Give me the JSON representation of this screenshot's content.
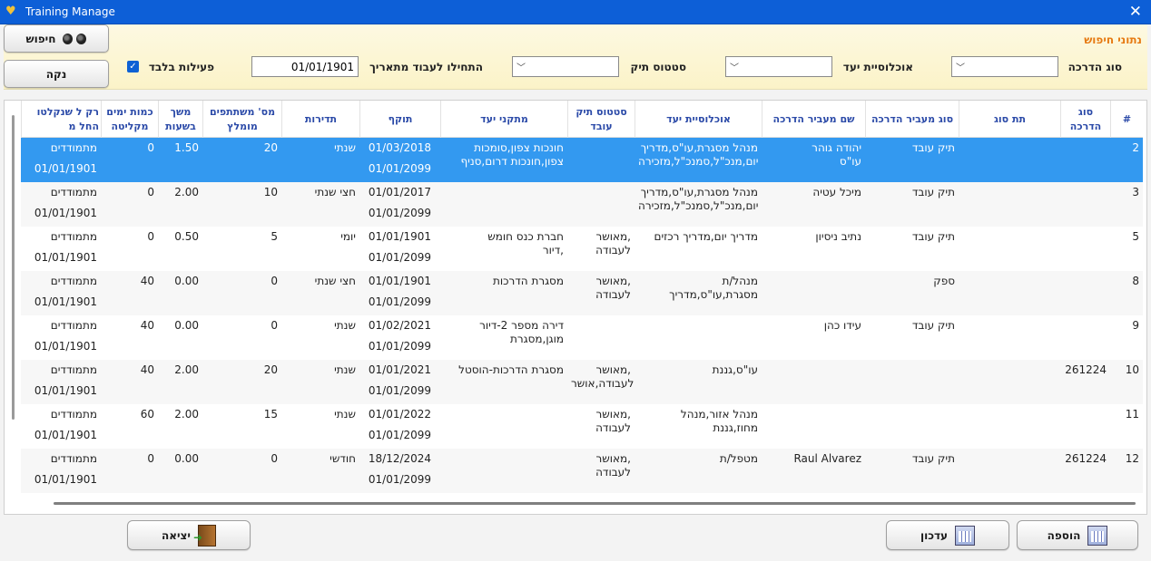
{
  "window": {
    "title": "Training Manage"
  },
  "search_panel": {
    "title": "נתוני חיפוש",
    "search_label": "חיפוש",
    "clear_label": "נקה",
    "fields": {
      "training_type_label": "סוג הדרכה",
      "target_population_label": "אוכלוסיית יעד",
      "file_status_label": "סטטוס תיק",
      "start_date_label": "התחילו לעבוד מתאריך",
      "start_date_value": "01/01/1901",
      "active_only_label": "פעילות בלבד",
      "active_only_checked": true
    }
  },
  "table": {
    "headers": [
      "#",
      "סוג הדרכה",
      "תת סוג",
      "סוג מעביר הדרכה",
      "שם מעביר הדרכה",
      "אוכלוסיית יעד",
      "סטטוס תיק עובד",
      "מתקני יעד",
      "תוקף",
      "תדירות",
      "מס' משתתפים מומלץ",
      "משך בשעות",
      "כמות ימים מקליטה",
      "רק ל שנקלטו החל מ"
    ],
    "rows": [
      {
        "num": "2",
        "type": "",
        "subtype": "",
        "instructor_type": "תיק עובד",
        "instructor_name_1": "יהודה גוהר",
        "instructor_name_2": "עו\"ס",
        "population_1": "מנהל מסגרת,עו\"ס,מדריך",
        "population_2": "יום,מנכ\"ל,סמנכ\"ל,מזכירה",
        "status_1": "",
        "status_2": "",
        "facilities_1": "חונכות צפון,סומכות",
        "facilities_2": "צפון,חונכות דרום,סניף",
        "valid_from": "01/03/2018",
        "valid_to": "01/01/2099",
        "frequency": "שנתי",
        "participants": "20",
        "duration": "1.50",
        "days": "0",
        "since_1": "מתמודדים",
        "since_2": "01/01/1901",
        "selected": true
      },
      {
        "num": "3",
        "type": "",
        "subtype": "",
        "instructor_type": "תיק עובד",
        "instructor_name_1": "מיכל עטיה",
        "instructor_name_2": "",
        "population_1": "מנהל מסגרת,עו\"ס,מדריך",
        "population_2": "יום,מנכ\"ל,סמנכ\"ל,מזכירה",
        "status_1": "",
        "status_2": "",
        "facilities_1": "",
        "facilities_2": "",
        "valid_from": "01/01/2017",
        "valid_to": "01/01/2099",
        "frequency": "חצי שנתי",
        "participants": "10",
        "duration": "2.00",
        "days": "0",
        "since_1": "מתמודדים",
        "since_2": "01/01/1901",
        "selected": false
      },
      {
        "num": "5",
        "type": "",
        "subtype": "",
        "instructor_type": "תיק עובד",
        "instructor_name_1": "נתיב ניסיון",
        "instructor_name_2": "",
        "population_1": "מדריך יום,מדריך רכזים",
        "population_2": "",
        "status_1": "מאושר,",
        "status_2": "לעבודה",
        "facilities_1": "חברת כנס חומש",
        "facilities_2": "דיור,",
        "valid_from": "01/01/1901",
        "valid_to": "01/01/2099",
        "frequency": "יומי",
        "participants": "5",
        "duration": "0.50",
        "days": "0",
        "since_1": "מתמודדים",
        "since_2": "01/01/1901",
        "selected": false
      },
      {
        "num": "8",
        "type": "",
        "subtype": "",
        "instructor_type": "ספק",
        "instructor_name_1": "",
        "instructor_name_2": "",
        "population_1": "מנהל/ת",
        "population_2": "מסגרת,עו\"ס,מדריך",
        "status_1": "מאושר,",
        "status_2": "לעבודה",
        "facilities_1": "מסגרת הדרכות",
        "facilities_2": "",
        "valid_from": "01/01/1901",
        "valid_to": "01/01/2099",
        "frequency": "חצי שנתי",
        "participants": "0",
        "duration": "0.00",
        "days": "40",
        "since_1": "מתמודדים",
        "since_2": "01/01/1901",
        "selected": false
      },
      {
        "num": "9",
        "type": "",
        "subtype": "",
        "instructor_type": "תיק עובד",
        "instructor_name_1": "עידו כהן",
        "instructor_name_2": "",
        "population_1": "",
        "population_2": "",
        "status_1": "",
        "status_2": "",
        "facilities_1": "דירה מספר 2-דיור",
        "facilities_2": "מוגן,מסגרת",
        "valid_from": "01/02/2021",
        "valid_to": "01/01/2099",
        "frequency": "שנתי",
        "participants": "0",
        "duration": "0.00",
        "days": "40",
        "since_1": "מתמודדים",
        "since_2": "01/01/1901",
        "selected": false
      },
      {
        "num": "10",
        "type": "261224",
        "subtype": "",
        "instructor_type": "",
        "instructor_name_1": "",
        "instructor_name_2": "",
        "population_1": "עו\"ס,גננת",
        "population_2": "",
        "status_1": "מאושר,",
        "status_2": "לעבודה,אושר",
        "facilities_1": "מסגרת הדרכות-הוסטל",
        "facilities_2": "",
        "valid_from": "01/01/2021",
        "valid_to": "01/01/2099",
        "frequency": "שנתי",
        "participants": "20",
        "duration": "2.00",
        "days": "40",
        "since_1": "מתמודדים",
        "since_2": "01/01/1901",
        "selected": false
      },
      {
        "num": "11",
        "type": "",
        "subtype": "",
        "instructor_type": "",
        "instructor_name_1": "",
        "instructor_name_2": "",
        "population_1": "מנהל אזור,מנהל",
        "population_2": "מחוז,גננת",
        "status_1": "מאושר,",
        "status_2": "לעבודה",
        "facilities_1": "",
        "facilities_2": "",
        "valid_from": "01/01/2022",
        "valid_to": "01/01/2099",
        "frequency": "שנתי",
        "participants": "15",
        "duration": "2.00",
        "days": "60",
        "since_1": "מתמודדים",
        "since_2": "01/01/1901",
        "selected": false
      },
      {
        "num": "12",
        "type": "261224",
        "subtype": "",
        "instructor_type": "תיק עובד",
        "instructor_name_1": "Raul Alvarez",
        "instructor_name_2": "",
        "population_1": "מטפל/ת",
        "population_2": "",
        "status_1": "מאושר,",
        "status_2": "לעבודה",
        "facilities_1": "",
        "facilities_2": "",
        "valid_from": "18/12/2024",
        "valid_to": "01/01/2099",
        "frequency": "חודשי",
        "participants": "0",
        "duration": "0.00",
        "days": "0",
        "since_1": "מתמודדים",
        "since_2": "01/01/1901",
        "selected": false
      }
    ]
  },
  "footer": {
    "add_label": "הוספה",
    "update_label": "עדכון",
    "exit_label": "יציאה"
  },
  "colors": {
    "title_bar": "#0d5fd7",
    "panel_title": "#e67a12",
    "header_text": "#2b4aa8",
    "selection": "#3399f0"
  }
}
